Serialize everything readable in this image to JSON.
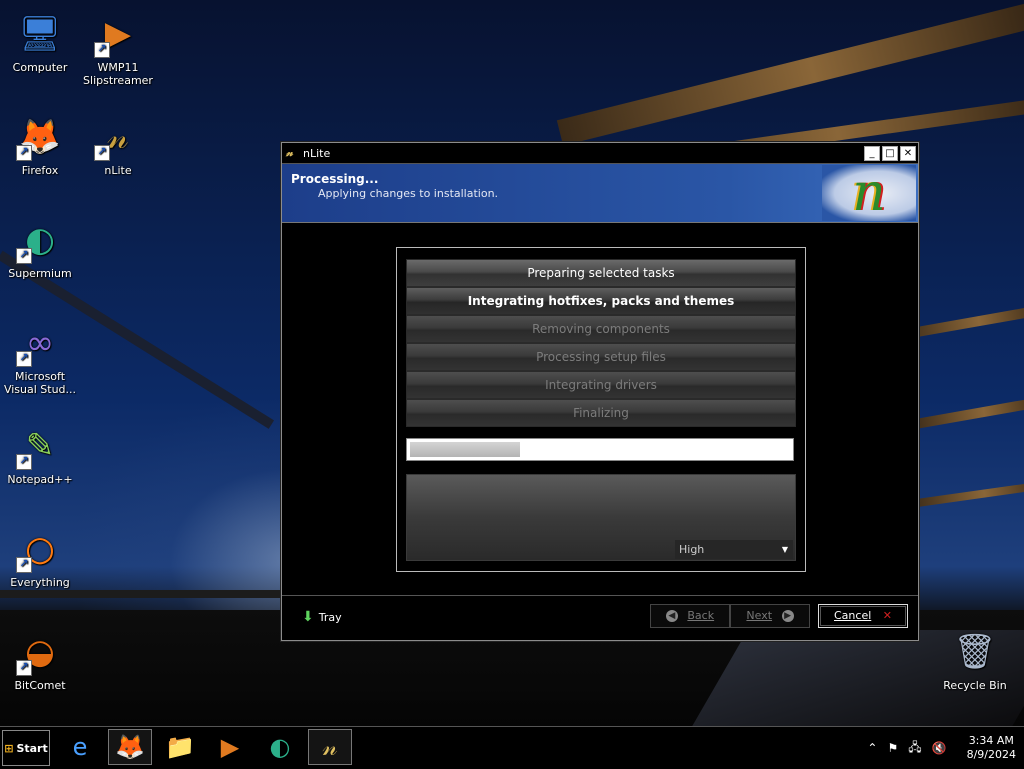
{
  "desktop": {
    "icons": [
      {
        "name": "computer-icon",
        "label": "Computer",
        "glyph": "🖥",
        "shortcut": false
      },
      {
        "name": "wmp11-slipstreamer-icon",
        "label": "WMP11 Slipstreamer",
        "glyph": "▶",
        "shortcut": true
      },
      {
        "name": "firefox-icon",
        "label": "Firefox",
        "glyph": "🦊",
        "shortcut": true
      },
      {
        "name": "nlite-icon",
        "label": "nLite",
        "glyph": "𝓃",
        "shortcut": true
      },
      {
        "name": "supermium-icon",
        "label": "Supermium",
        "glyph": "◐",
        "shortcut": true
      },
      {
        "name": "visual-studio-icon",
        "label": "Microsoft Visual Stud...",
        "glyph": "∞",
        "shortcut": true
      },
      {
        "name": "notepad-plus-plus-icon",
        "label": "Notepad++",
        "glyph": "✎",
        "shortcut": true
      },
      {
        "name": "everything-icon",
        "label": "Everything",
        "glyph": "○",
        "shortcut": true
      },
      {
        "name": "bitcomet-icon",
        "label": "BitComet",
        "glyph": "◒",
        "shortcut": true
      },
      {
        "name": "recycle-bin-icon",
        "label": "Recycle Bin",
        "glyph": "🗑",
        "shortcut": false
      }
    ]
  },
  "window": {
    "title": "nLite",
    "icon": "nlite-icon",
    "controls": {
      "minimize": "_",
      "maximize": "□",
      "close": "✕"
    },
    "header": {
      "title": "Processing...",
      "subtitle": "Applying changes to installation."
    },
    "steps": [
      {
        "label": "Preparing selected tasks",
        "state": "done"
      },
      {
        "label": "Integrating hotfixes, packs and themes",
        "state": "active"
      },
      {
        "label": "Removing components",
        "state": "pending"
      },
      {
        "label": "Processing setup files",
        "state": "pending"
      },
      {
        "label": "Integrating drivers",
        "state": "pending"
      },
      {
        "label": "Finalizing",
        "state": "pending"
      }
    ],
    "progress": 0.29,
    "priority": {
      "selected": "High"
    },
    "footer": {
      "tray_label": "Tray",
      "back_label": "Back",
      "next_label": "Next",
      "cancel_label": "Cancel"
    }
  },
  "taskbar": {
    "start_label": "Start",
    "apps": [
      {
        "name": "internet-explorer-icon",
        "glyph": "e",
        "open": false
      },
      {
        "name": "firefox-taskbar-icon",
        "glyph": "🦊",
        "open": true
      },
      {
        "name": "file-explorer-icon",
        "glyph": "📁",
        "open": false
      },
      {
        "name": "wmp-taskbar-icon",
        "glyph": "▶",
        "open": false
      },
      {
        "name": "supermium-taskbar-icon",
        "glyph": "◐",
        "open": false
      },
      {
        "name": "nlite-taskbar-icon",
        "glyph": "𝓃",
        "open": true
      }
    ],
    "tray": {
      "time": "3:34 AM",
      "date": "8/9/2024"
    }
  },
  "colors": {
    "banner": "#2a56a6",
    "accent_cancel": "#d02020"
  }
}
